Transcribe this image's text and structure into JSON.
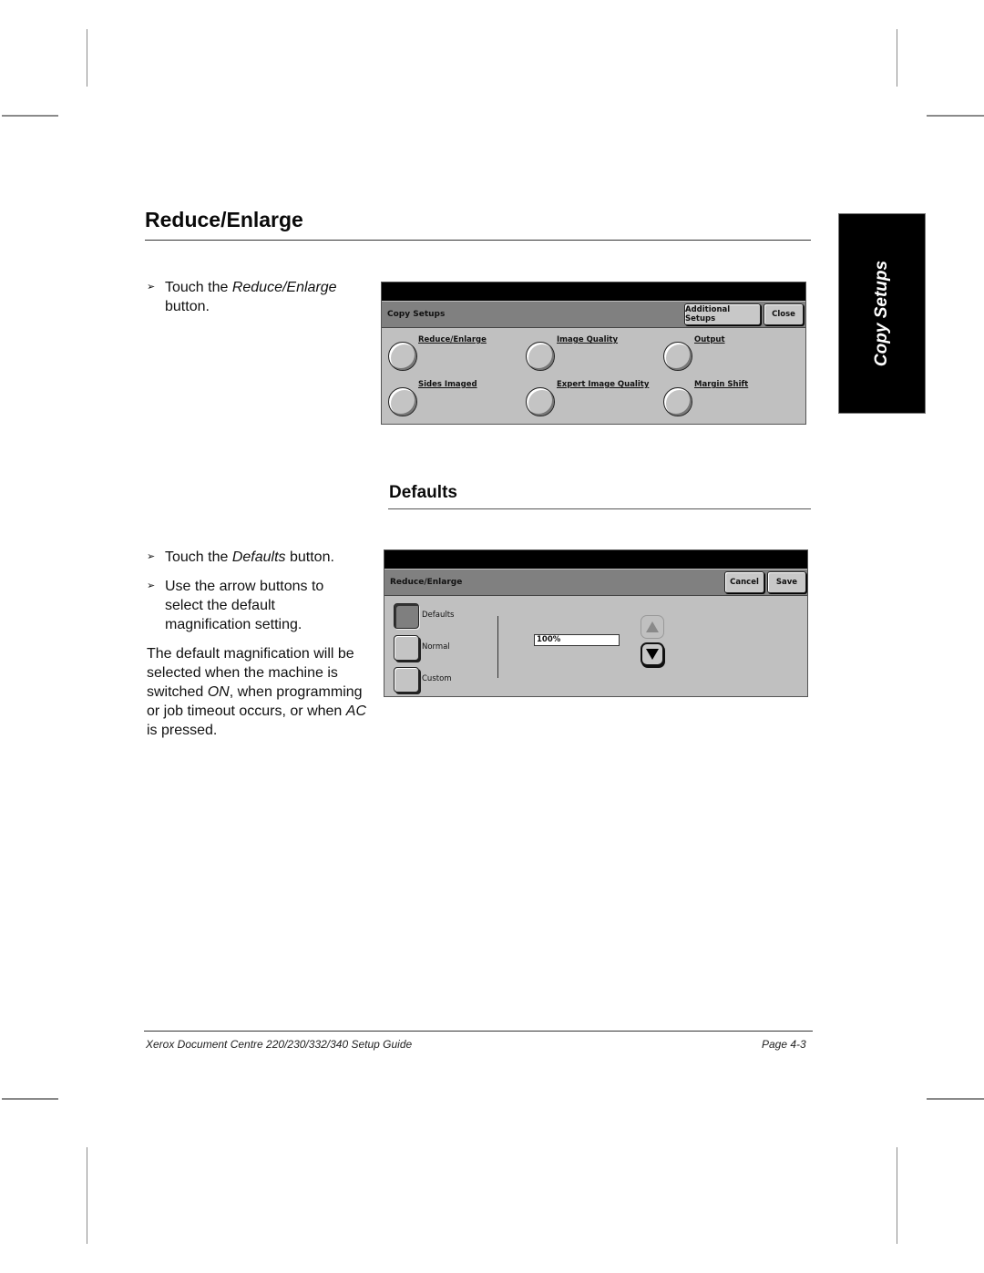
{
  "page": {
    "heading": "Reduce/Enlarge",
    "side_tab": "Copy Setups",
    "subheading": "Defaults",
    "step1": {
      "prefix": "Touch the ",
      "emphasis": "Reduce/Enlarge",
      "suffix": " button."
    },
    "step2": {
      "prefix": "Touch the ",
      "emphasis": "Defaults",
      "suffix": " button."
    },
    "step3": {
      "text": "Use the arrow buttons to select the default magnification setting."
    },
    "note": {
      "part1": "The default magnification will be selected when the machine is switched ",
      "em1": "ON",
      "part2": ", when programming or job timeout occurs, or when ",
      "em2": "AC",
      "part3": " is pressed."
    },
    "bullet_icon": "arrowhead-right-icon",
    "footer": {
      "title": "Xerox Document Centre 220/230/332/340 Setup Guide",
      "page": "Page 4-3"
    }
  },
  "screen1": {
    "title": "Copy Setups",
    "buttons": {
      "additional": "Additional Setups",
      "close": "Close"
    },
    "options": [
      {
        "label": "Reduce/Enlarge"
      },
      {
        "label": "Image Quality"
      },
      {
        "label": "Output"
      },
      {
        "label": "Sides Imaged"
      },
      {
        "label": "Expert Image Quality"
      },
      {
        "label": "Margin Shift"
      }
    ]
  },
  "screen2": {
    "title": "Reduce/Enlarge",
    "buttons": {
      "cancel": "Cancel",
      "save": "Save"
    },
    "options": [
      {
        "label": "Defaults",
        "selected": true
      },
      {
        "label": "Normal",
        "selected": false
      },
      {
        "label": "Custom",
        "selected": false
      }
    ],
    "value": "100%",
    "arrows": {
      "up": "arrow-up-icon",
      "down": "arrow-down-icon"
    }
  }
}
